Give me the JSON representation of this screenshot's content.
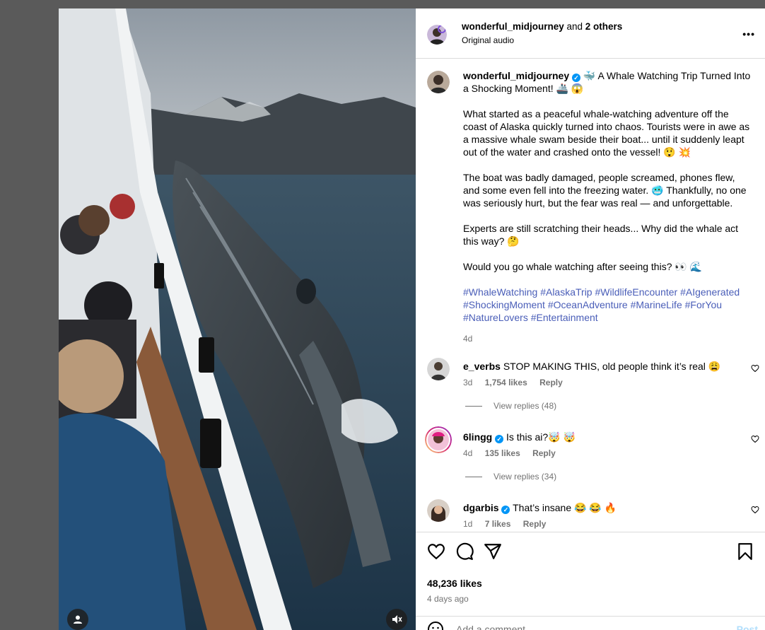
{
  "header": {
    "username": "wonderful_midjourney",
    "and_text": " and ",
    "others": "2 others",
    "audio": "Original audio",
    "more": "•••"
  },
  "caption": {
    "username": "wonderful_midjourney",
    "title": " 🐳 A Whale Watching Trip Turned Into a Shocking Moment! 🚢 😱",
    "p1": "What started as a peaceful whale-watching adventure off the coast of Alaska quickly turned into chaos. Tourists were in awe as a massive whale swam beside their boat... until it suddenly leapt out of the water and crashed onto the vessel! 😲 💥",
    "p2": "The boat was badly damaged, people screamed, phones flew, and some even fell into the freezing water. 🥶 Thankfully, no one was seriously hurt, but the fear was real — and unforgettable.",
    "p3": "Experts are still scratching their heads... Why did the whale act this way? 🤔",
    "p4": "Would you go whale watching after seeing this? 👀 🌊",
    "hashtags": "#WhaleWatching #AlaskaTrip #WildlifeEncounter #AIgenerated #ShockingMoment #OceanAdventure #MarineLife #ForYou #NatureLovers #Entertainment",
    "age": "4d"
  },
  "comments": [
    {
      "username": "e_verbs",
      "text": " STOP MAKING THIS, old people think it’s real 😩",
      "age": "3d",
      "likes": "1,754 likes",
      "reply": "Reply",
      "view_replies": "View replies (48)"
    },
    {
      "username": "6lingg",
      "text": " Is this ai?🤯 🤯",
      "age": "4d",
      "likes": "135 likes",
      "reply": "Reply",
      "view_replies": "View replies (34)"
    },
    {
      "username": "dgarbis",
      "text": " That’s insane 😂 😂 🔥",
      "age": "1d",
      "likes": "7 likes",
      "reply": "Reply"
    }
  ],
  "footer": {
    "likes": "48,236 likes",
    "when": "4 days ago",
    "add_comment": "Add a comment...",
    "post": "Post"
  },
  "colors": {
    "verified": "#0095f6",
    "hashtag": "#4a5eb8",
    "muted": "#737373"
  }
}
